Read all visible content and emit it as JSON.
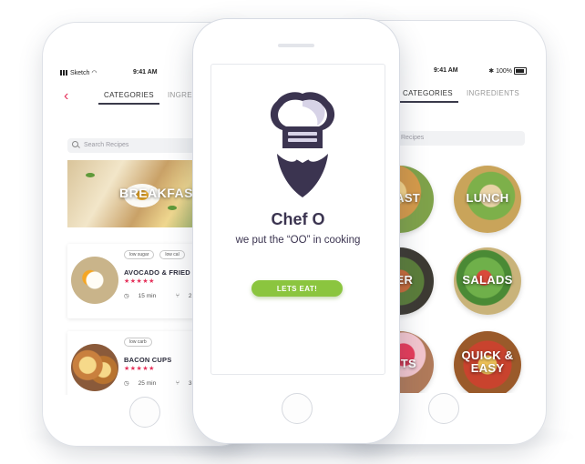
{
  "left_phone": {
    "status": {
      "carrier": "Sketch",
      "time": "9:41 AM"
    },
    "tabs": [
      {
        "label": "CATEGORIES",
        "active": true
      },
      {
        "label": "INGREDIE",
        "active": false
      }
    ],
    "search_placeholder": "Search Recipes",
    "banner_title": "BREAKFAST",
    "recipes": [
      {
        "tags": [
          "low sugar",
          "low cal"
        ],
        "title": "AVOCADO & FRIED EGG",
        "stars": "★★★★★",
        "time": "15 min",
        "servings": "2 serv"
      },
      {
        "tags": [
          "low carb"
        ],
        "title": "BACON CUPS",
        "stars": "★★★★★",
        "time": "25 min",
        "servings": "3 serv"
      }
    ]
  },
  "center_phone": {
    "brand_name": "Chef O",
    "tagline": "we put the “OO” in cooking",
    "cta_label": "LETS EAT!"
  },
  "right_phone": {
    "status": {
      "time": "9:41 AM",
      "battery": "100%"
    },
    "tabs": [
      {
        "label": "CATEGORIES",
        "active": true
      },
      {
        "label": "INGREDIENTS",
        "active": false
      }
    ],
    "search_placeholder": "Recipes",
    "categories": [
      "KFAST",
      "LUNCH",
      "NER",
      "SALADS",
      "ERTS",
      "QUICK & EASY"
    ]
  },
  "colors": {
    "accent": "#e5315a",
    "cta": "#8bc53f",
    "brand": "#3b3450"
  }
}
